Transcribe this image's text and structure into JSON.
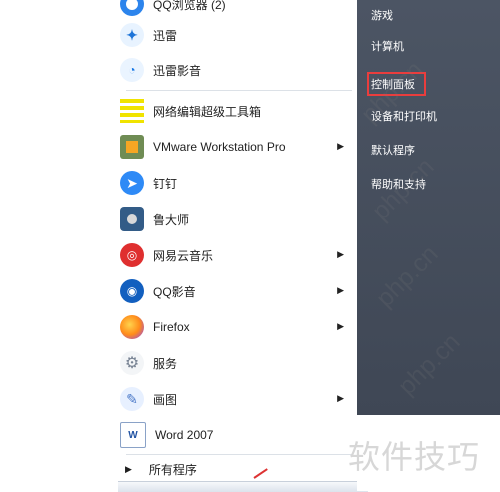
{
  "left_menu": {
    "items": [
      {
        "label": "QQ浏览器 (2)",
        "icon": "qq-browser-icon",
        "arrow": false
      },
      {
        "label": "迅雷",
        "icon": "xunlei-icon",
        "arrow": false
      },
      {
        "label": "迅雷影音",
        "icon": "xunlei-player-icon",
        "arrow": false
      },
      {
        "label": "网络编辑超级工具箱",
        "icon": "toolbox-icon",
        "arrow": false
      },
      {
        "label": "VMware Workstation Pro",
        "icon": "vmware-icon",
        "arrow": true
      },
      {
        "label": "钉钉",
        "icon": "dingtalk-icon",
        "arrow": false
      },
      {
        "label": "鲁大师",
        "icon": "ludashi-icon",
        "arrow": false
      },
      {
        "label": "网易云音乐",
        "icon": "netease-music-icon",
        "arrow": true
      },
      {
        "label": "QQ影音",
        "icon": "qq-player-icon",
        "arrow": true
      },
      {
        "label": "Firefox",
        "icon": "firefox-icon",
        "arrow": true
      },
      {
        "label": "服务",
        "icon": "services-gear-icon",
        "arrow": false
      },
      {
        "label": "画图",
        "icon": "paint-icon",
        "arrow": true
      },
      {
        "label": "Word 2007",
        "icon": "word-icon",
        "arrow": false
      }
    ],
    "all_programs_label": "所有程序"
  },
  "right_menu": {
    "items": [
      {
        "label": "游戏"
      },
      {
        "label": "计算机"
      },
      {
        "label": "控制面板"
      },
      {
        "label": "设备和打印机"
      },
      {
        "label": "默认程序"
      },
      {
        "label": "帮助和支持"
      }
    ]
  },
  "colors": {
    "right_pane": "#434b59",
    "highlight": "#ea3d3d"
  },
  "watermarks": [
    "php.cn",
    "php.cn",
    "php.cn",
    "php.cn"
  ],
  "brand_text": "软件技巧"
}
